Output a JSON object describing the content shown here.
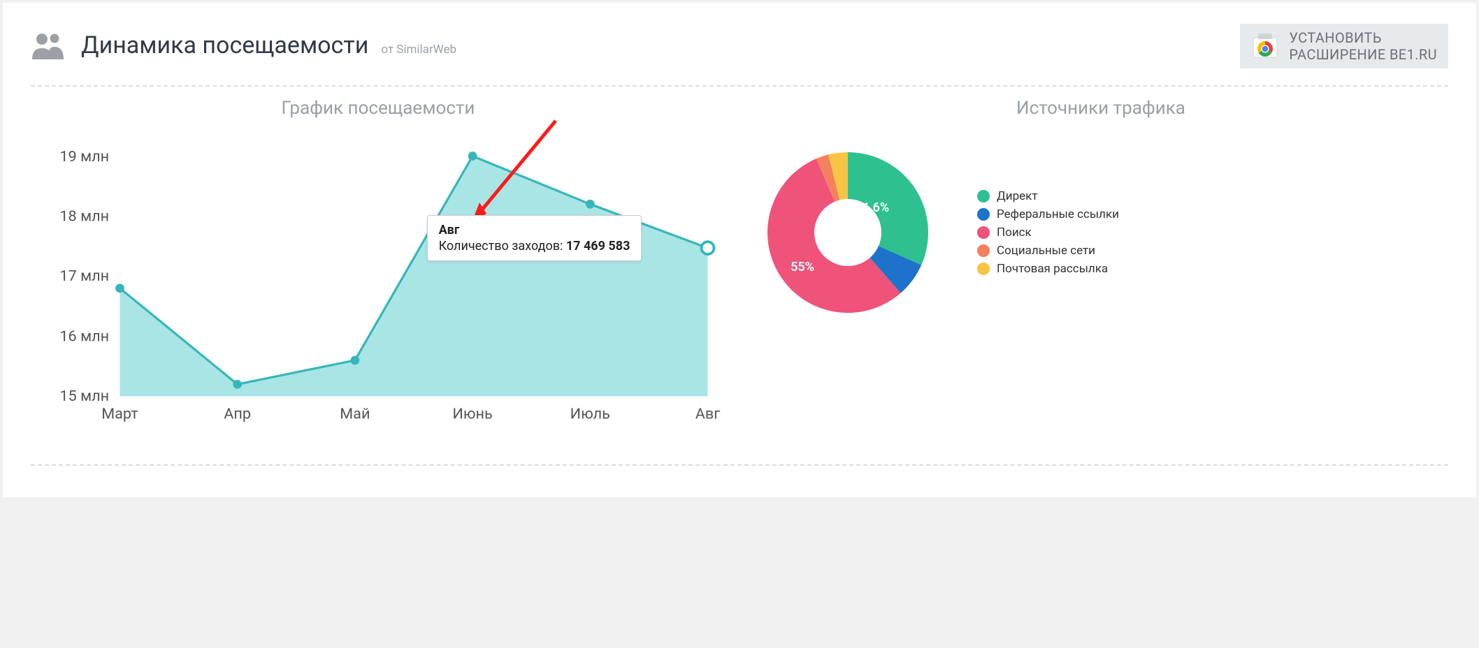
{
  "header": {
    "title": "Динамика посещаемости",
    "subtitle": "от SimilarWeb"
  },
  "banner": {
    "line1": "УСТАНОВИТЬ",
    "line2": "РАСШИРЕНИЕ BE1.RU"
  },
  "line_chart": {
    "title": "График посещаемости",
    "yTicks": [
      "15 млн",
      "16 млн",
      "17 млн",
      "18 млн",
      "19 млн"
    ],
    "xTicks": [
      "Март",
      "Апр",
      "Май",
      "Июнь",
      "Июль",
      "Авг"
    ],
    "tooltip": {
      "month": "Авг",
      "label": "Количество заходов: ",
      "value": "17 469 583"
    }
  },
  "donut": {
    "title": "Источники трафика",
    "slice_labels": {
      "direct": "31,6%",
      "search": "55%"
    },
    "legend": [
      {
        "label": "Директ",
        "color": "#2fc090"
      },
      {
        "label": "Реферальные ссылки",
        "color": "#1d73c9"
      },
      {
        "label": "Поиск",
        "color": "#ef537a"
      },
      {
        "label": "Социальные сети",
        "color": "#f5805d"
      },
      {
        "label": "Почтовая рассылка",
        "color": "#f7c443"
      }
    ]
  },
  "chart_data": [
    {
      "type": "line",
      "title": "График посещаемости",
      "xlabel": "",
      "ylabel": "",
      "ylim": [
        15000000,
        19000000
      ],
      "categories": [
        "Март",
        "Апр",
        "Май",
        "Июнь",
        "Июль",
        "Авг"
      ],
      "values": [
        16800000,
        15200000,
        15600000,
        19000000,
        18200000,
        17469583
      ],
      "annotations": [
        {
          "x": "Авг",
          "y": 17469583,
          "text": "Количество заходов: 17 469 583"
        }
      ]
    },
    {
      "type": "pie",
      "title": "Источники трафика",
      "series": [
        {
          "name": "Директ",
          "value": 31.6,
          "color": "#2fc090"
        },
        {
          "name": "Реферальные ссылки",
          "value": 7.0,
          "color": "#1d73c9"
        },
        {
          "name": "Поиск",
          "value": 55.0,
          "color": "#ef537a"
        },
        {
          "name": "Социальные сети",
          "value": 2.5,
          "color": "#f5805d"
        },
        {
          "name": "Почтовая рассылка",
          "value": 3.9,
          "color": "#f7c443"
        }
      ]
    }
  ]
}
